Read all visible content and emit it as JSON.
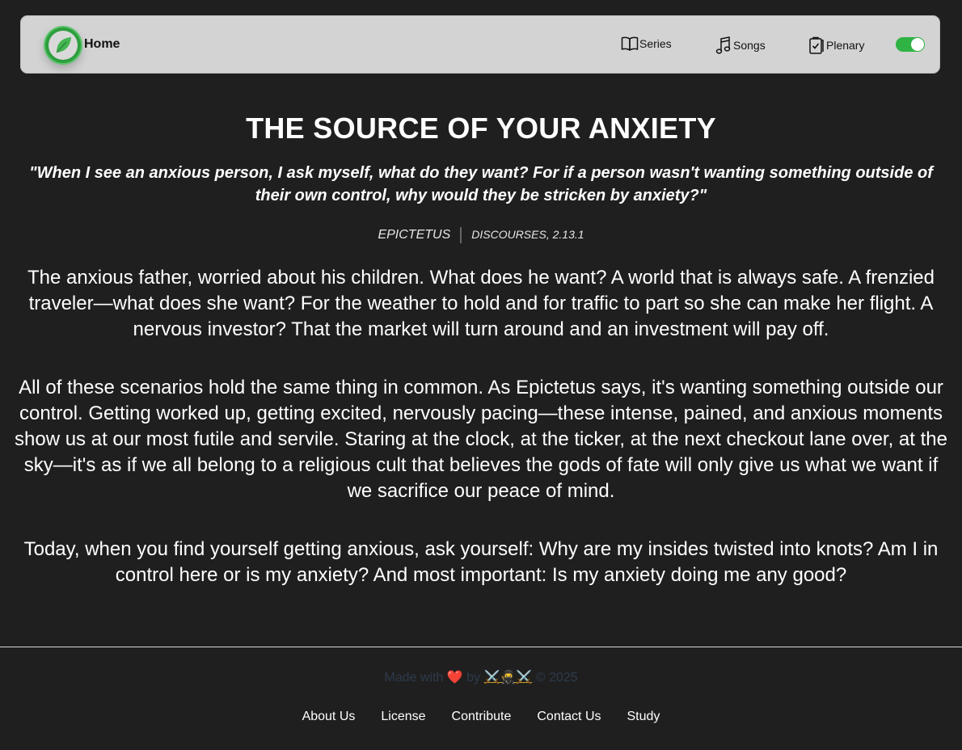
{
  "nav": {
    "home_label": "Home",
    "items": [
      {
        "label": "Series",
        "icon": "book-open-icon"
      },
      {
        "label": "Songs",
        "icon": "music-note-icon"
      },
      {
        "label": "Plenary",
        "icon": "clipboard-check-icon"
      }
    ],
    "theme_toggle_on": true
  },
  "article": {
    "title": "THE SOURCE OF YOUR ANXIETY",
    "quote": "\"When I see an anxious person, I ask myself, what do they want? For if a person wasn't wanting something outside of their own control, why would they be stricken by anxiety?\"",
    "author": "EPICTETUS",
    "source": "DISCOURSES, 2.13.1",
    "paragraphs": [
      "The anxious father, worried about his children. What does he want? A world that is always safe. A frenzied traveler—what does she want? For the weather to hold and for traffic to part so she can make her flight. A nervous investor? That the market will turn around and an investment will pay off.",
      "All of these scenarios hold the same thing in common. As Epictetus says, it's wanting something outside our control. Getting worked up, getting excited, nervously pacing—these intense, pained, and anxious moments show us at our most futile and servile. Staring at the clock, at the ticker, at the next checkout lane over, at the sky—it's as if we all belong to a religious cult that believes the gods of fate will only give us what we want if we sacrifice our peace of mind.",
      "Today, when you find yourself getting anxious, ask yourself: Why are my insides twisted into knots? Am I in control here or is my anxiety? And most important: Is my anxiety doing me any good?"
    ]
  },
  "footer": {
    "made_prefix": "Made with",
    "heart": "❤️",
    "by": "by",
    "author_emoji": "⚔️🥷⚔️",
    "copyright": "© 2025",
    "links": [
      "About Us",
      "License",
      "Contribute",
      "Contact Us",
      "Study"
    ]
  },
  "colors": {
    "background": "#1f1f1f",
    "navbar": "#d3d3d3",
    "accent_green": "#2fb344",
    "footer_text": "#2e3b4c"
  }
}
